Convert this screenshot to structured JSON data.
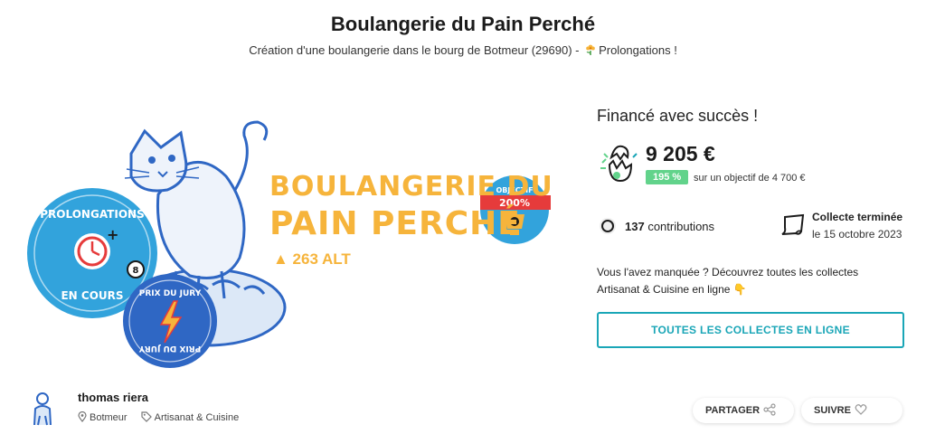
{
  "header": {
    "title": "Boulangerie du Pain Perché",
    "subtitle_text": "Création d'une boulangerie dans le bourg de Botmeur (29690) - ",
    "subtitle_extra": "Prolongations !"
  },
  "hero": {
    "title_line1": "BOULANGERIE DU",
    "title_line2": "PAIN PERCHÉ",
    "altitude": "▲ 263 ALT",
    "badge_prolongations_top": "PROLONGATIONS",
    "badge_prolongations_bottom": "EN COURS",
    "badge_jury_top": "PRIX DU JURY",
    "badge_jury_bottom": "PRIX DU JURY",
    "badge_objectif_label": "OBJECTIF",
    "badge_objectif_value": "200%",
    "colors": {
      "blue": "#2f67c4",
      "teal": "#32a3dc",
      "yellow": "#f6b43b",
      "red": "#e63b3b"
    }
  },
  "funding": {
    "status": "Financé avec succès !",
    "amount": "9 205 €",
    "percent": "195 %",
    "objective": "sur un objectif de 4 700 €",
    "contributions_count": "137",
    "contributions_label": " contributions",
    "end_label": "Collecte terminée",
    "end_date": "le 15 octobre 2023"
  },
  "missed": {
    "text": "Vous l'avez manquée ? Découvrez toutes les collectes Artisanat & Cuisine en ligne 👇"
  },
  "buttons": {
    "all_collects": "TOUTES LES COLLECTES EN LIGNE",
    "share": "PARTAGER",
    "follow": "SUIVRE"
  },
  "author": {
    "name": "thomas riera",
    "location": "Botmeur",
    "category": "Artisanat & Cuisine"
  },
  "icons": [
    "flower-icon",
    "egg-icon",
    "contributions-icon",
    "calendar-icon",
    "location-icon",
    "tag-icon",
    "share-icon",
    "heart-icon"
  ]
}
